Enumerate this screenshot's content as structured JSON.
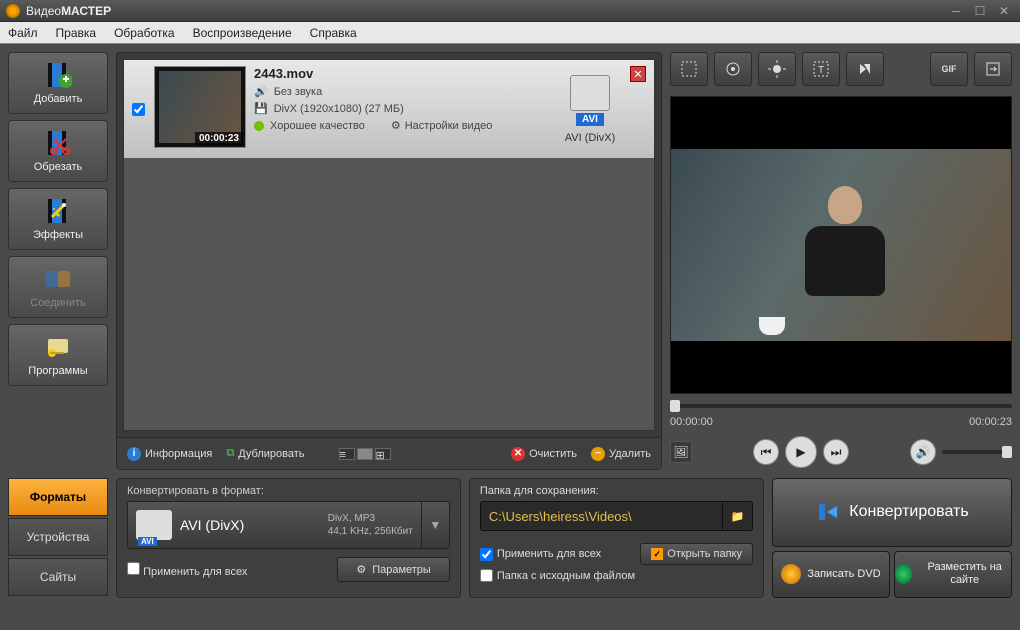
{
  "title": {
    "prefix": "Видео",
    "suffix": "МАСТЕР"
  },
  "menu": [
    "Файл",
    "Правка",
    "Обработка",
    "Воспроизведение",
    "Справка"
  ],
  "sidebar": [
    {
      "label": "Добавить",
      "name": "sidebar-add",
      "disabled": false
    },
    {
      "label": "Обрезать",
      "name": "sidebar-cut",
      "disabled": false
    },
    {
      "label": "Эффекты",
      "name": "sidebar-effects",
      "disabled": false
    },
    {
      "label": "Соединить",
      "name": "sidebar-join",
      "disabled": true
    },
    {
      "label": "Программы",
      "name": "sidebar-programs",
      "disabled": false
    }
  ],
  "file": {
    "name": "2443.mov",
    "duration": "00:00:23",
    "audio": "Без звука",
    "codec": "DivX (1920x1080) (27 МБ)",
    "quality": "Хорошее качество",
    "settings": "Настройки видео",
    "fmt_badge": "AVI",
    "fmt_label": "AVI (DivX)"
  },
  "list_toolbar": {
    "info": "Информация",
    "duplicate": "Дублировать",
    "clear": "Очистить",
    "delete": "Удалить"
  },
  "preview": {
    "time_start": "00:00:00",
    "time_end": "00:00:23"
  },
  "fmt_tabs": {
    "formats": "Форматы",
    "devices": "Устройства",
    "sites": "Сайты"
  },
  "convert_to": {
    "header": "Конвертировать в формат:",
    "name": "AVI (DivX)",
    "details1": "DivX, MP3",
    "details2": "44,1 KHz, 256Кбит",
    "apply_all": "Применить для всех",
    "params": "Параметры",
    "avibadge": "AVI"
  },
  "save": {
    "header": "Папка для сохранения:",
    "path": "C:\\Users\\heiress\\Videos\\",
    "apply_all": "Применить для всех",
    "source_folder": "Папка с исходным файлом",
    "open_folder": "Открыть папку"
  },
  "actions": {
    "convert": "Конвертировать",
    "dvd": "Записать DVD",
    "upload": "Разместить на сайте"
  }
}
